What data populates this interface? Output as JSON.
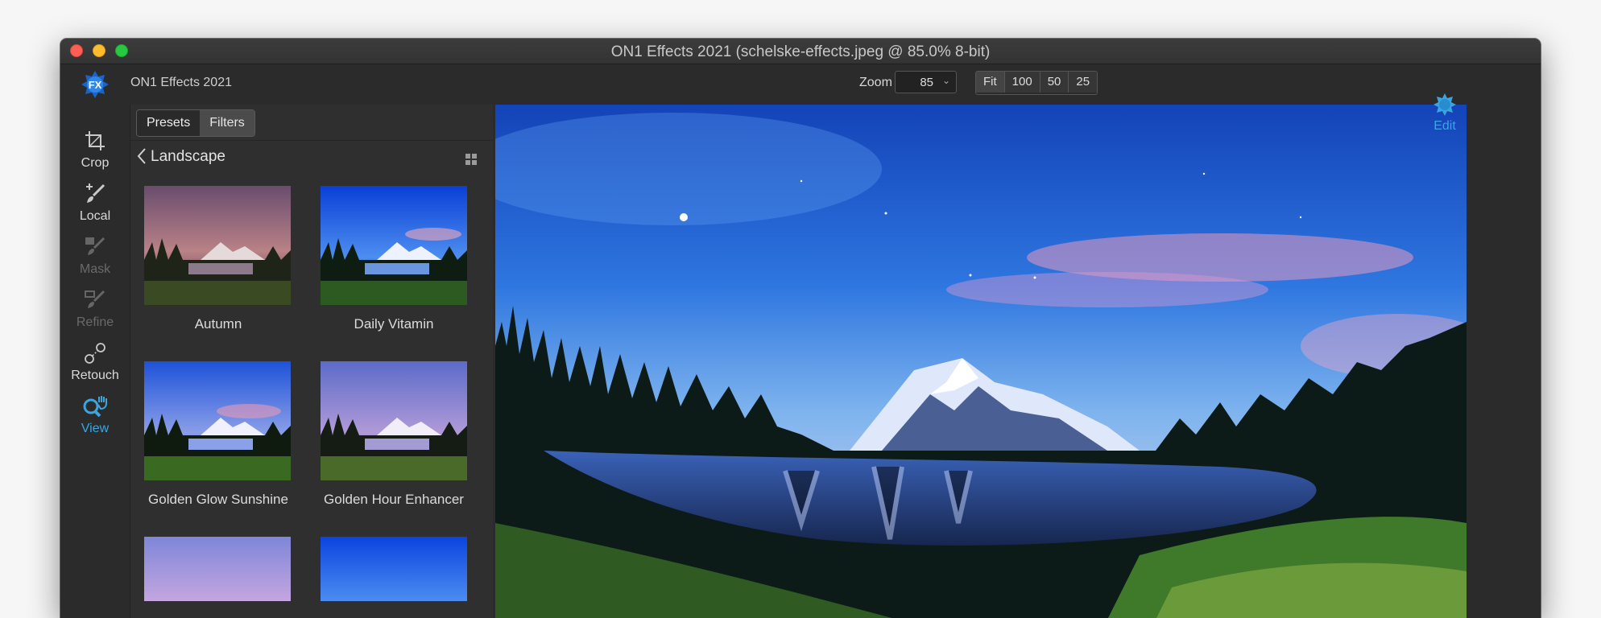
{
  "window": {
    "title": "ON1 Effects 2021 (schelske-effects.jpeg @ 85.0% 8-bit)"
  },
  "app": {
    "name": "ON1 Effects 2021",
    "logo_text": "FX"
  },
  "zoom": {
    "label": "Zoom",
    "value": "85",
    "buttons": [
      "Fit",
      "100",
      "50",
      "25"
    ]
  },
  "tools": [
    {
      "label": "Crop",
      "icon": "crop-icon",
      "state": "normal"
    },
    {
      "label": "Local",
      "icon": "brush-icon",
      "state": "normal"
    },
    {
      "label": "Mask",
      "icon": "mask-brush-icon",
      "state": "disabled"
    },
    {
      "label": "Refine",
      "icon": "refine-brush-icon",
      "state": "disabled"
    },
    {
      "label": "Retouch",
      "icon": "retouch-icon",
      "state": "normal"
    },
    {
      "label": "View",
      "icon": "view-hand-magnifier-icon",
      "state": "active"
    }
  ],
  "panel": {
    "tabs": [
      "Presets",
      "Filters"
    ],
    "active_tab": "Presets",
    "category": "Landscape",
    "presets": [
      {
        "name": "Autumn"
      },
      {
        "name": "Daily Vitamin"
      },
      {
        "name": "Golden Glow Sunshine"
      },
      {
        "name": "Golden Hour Enhancer"
      },
      {
        "name": ""
      },
      {
        "name": ""
      }
    ]
  },
  "modules": [
    {
      "label": "Edit",
      "icon": "effects-fx-icon"
    }
  ],
  "colors": {
    "accent": "#3aa5e0",
    "background": "#2b2b2b",
    "panel": "#2f2f2f"
  }
}
